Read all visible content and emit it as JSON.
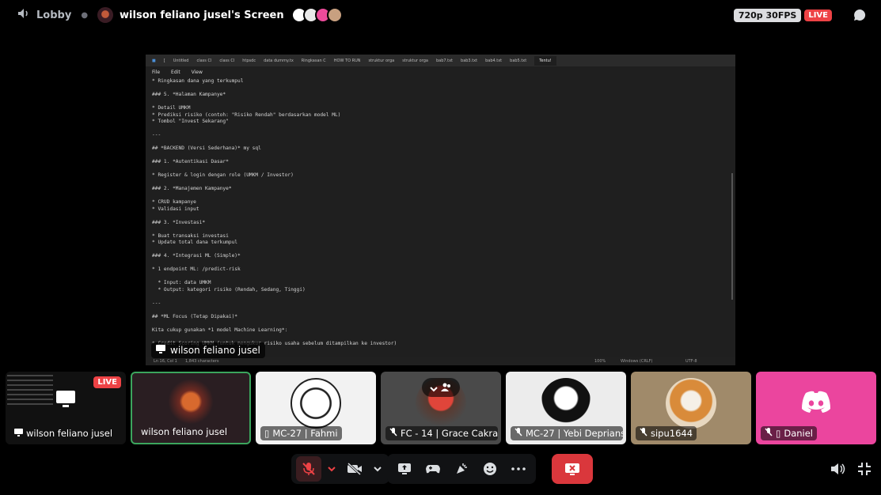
{
  "topbar": {
    "channel": "Lobby",
    "stream_title": "wilson feliano jusel's Screen",
    "quality": "720p 30FPS",
    "live": "LIVE"
  },
  "screen": {
    "tabs": [
      "[",
      "Untitled",
      "class Cl",
      "class Cl",
      "htpsdc",
      "data dummy.tx",
      "Ringkasan C",
      "HOW TO RUN",
      "struktur orga",
      "struktur orga",
      "bab7.txt",
      "bab3.txt",
      "bab4.txt",
      "bab5.txt",
      "Tentu!"
    ],
    "menu": [
      "File",
      "Edit",
      "View"
    ],
    "lines": [
      "* Ringkasan dana yang terkumpul",
      "",
      "### 5. *Halaman Kampanye*",
      "",
      "* Detail UMKM",
      "* Prediksi risiko (contoh: \"Risiko Rendah\" berdasarkan model ML)",
      "* Tombol \"Invest Sekarang\"",
      "",
      "---",
      "",
      "## *BACKEND (Versi Sederhana)* my sql",
      "",
      "### 1. *Autentikasi Dasar*",
      "",
      "* Register & login dengan role (UMKM / Investor)",
      "",
      "### 2. *Manajemen Kampanye*",
      "",
      "* CRUD kampanye",
      "* Validasi input",
      "",
      "### 3. *Investasi*",
      "",
      "* Buat transaksi investasi",
      "* Update total dana terkumpul",
      "",
      "### 4. *Integrasi ML (Simple)*",
      "",
      "* 1 endpoint ML: /predict-risk",
      "",
      "  * Input: data UMKM",
      "  * Output: kategori risiko (Rendah, Sedang, Tinggi)",
      "",
      "---",
      "",
      "## *ML Focus (Tetap Dipakai)*",
      "",
      "Kita cukup gunakan *1 model Machine Learning*:",
      "",
      "* Credit Scoring UMKM (untuk mengukur risiko usaha sebelum ditampilkan ke investor)"
    ],
    "status": {
      "position": "Ln 16, Col 1",
      "chars": "1,843 characters",
      "zoom": "100%",
      "eol": "Windows (CRLF)",
      "encoding": "UTF-8"
    },
    "owner_label": "wilson feliano jusel"
  },
  "tiles": [
    {
      "label": "wilson feliano jusel",
      "live": "LIVE"
    },
    {
      "label": "wilson feliano jusel"
    },
    {
      "label": "MC-27 | Fahmi"
    },
    {
      "label": "FC - 14 | Grace Cakra"
    },
    {
      "label": "MC-27 | Yebi Deprians..."
    },
    {
      "label": "sipu1644"
    },
    {
      "label": "Daniel"
    }
  ],
  "colors": {
    "live_red": "#ed4245",
    "leave_red": "#da373c",
    "speaking_green": "#3ba55d",
    "discord_pink": "#eb459e"
  }
}
